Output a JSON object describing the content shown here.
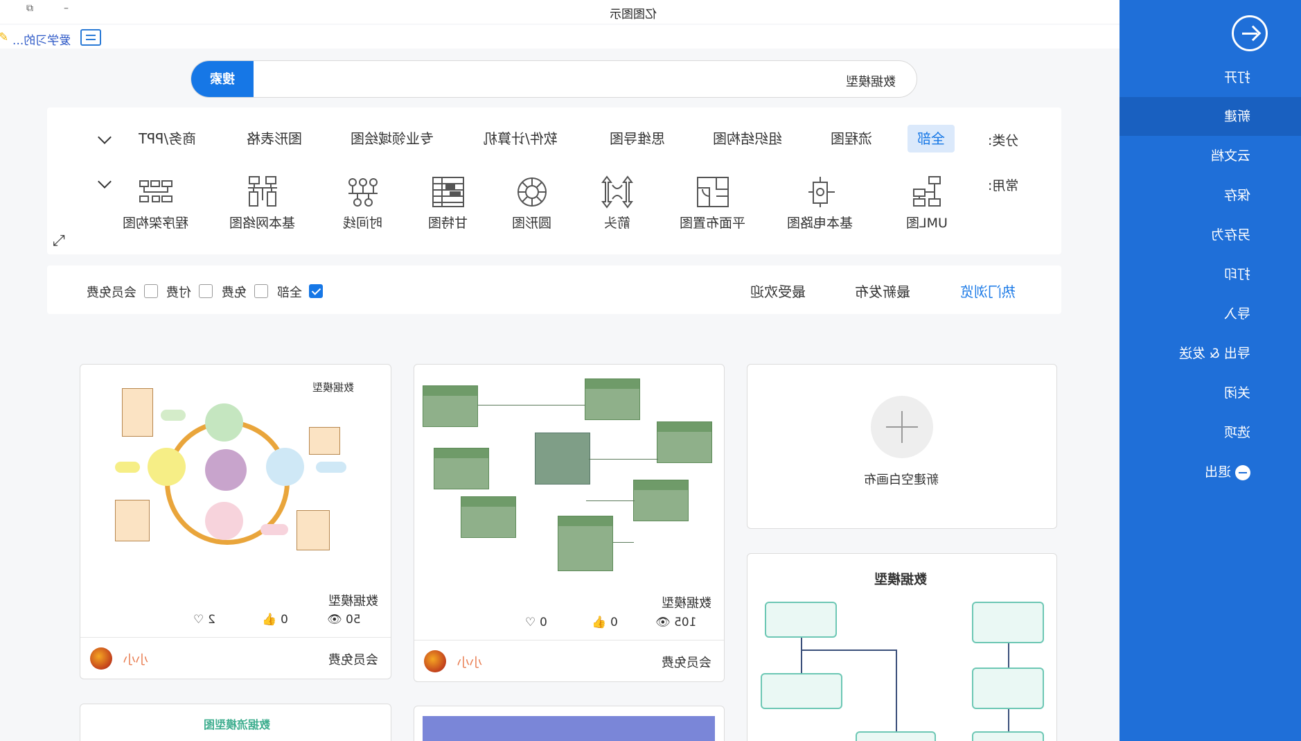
{
  "app": {
    "title": "亿图图示",
    "notice_text": "爱学习的..."
  },
  "search": {
    "button_label": "搜索",
    "value": "数据模型"
  },
  "categories": {
    "label": "分类:",
    "items": [
      "全部",
      "流程图",
      "组织结构图",
      "思维导图",
      "软件/计算机",
      "专业领域绘图",
      "图形表格",
      "商务/PPT"
    ],
    "active": "全部"
  },
  "common": {
    "label": "常用:",
    "items": [
      {
        "label": "UML图",
        "icon": "uml-icon"
      },
      {
        "label": "基本电路图",
        "icon": "circuit-icon"
      },
      {
        "label": "平面布置图",
        "icon": "floorplan-icon"
      },
      {
        "label": "箭头",
        "icon": "arrow-shape-icon"
      },
      {
        "label": "圆形图",
        "icon": "circle-diagram-icon"
      },
      {
        "label": "甘特图",
        "icon": "gantt-icon"
      },
      {
        "label": "时间线",
        "icon": "timeline-icon"
      },
      {
        "label": "基本网络图",
        "icon": "network-icon"
      },
      {
        "label": "程序架构图",
        "icon": "architecture-icon"
      }
    ]
  },
  "filter": {
    "sort_tabs": [
      "热门浏览",
      "最新发布",
      "最受欢迎"
    ],
    "active_sort": "热门浏览",
    "price_options": [
      {
        "label": "全部",
        "checked": true
      },
      {
        "label": "免费",
        "checked": false
      },
      {
        "label": "付费",
        "checked": false
      },
      {
        "label": "会员免费",
        "checked": false
      }
    ]
  },
  "new_blank": {
    "label": "新建空白画布"
  },
  "templates": [
    {
      "name": "数据模型",
      "views": "105",
      "likes": "0",
      "favorites": "0",
      "author": "小小",
      "price": "会员免费"
    },
    {
      "name": "数据模型",
      "diagram_title": "数据模型",
      "views": "50",
      "likes": "0",
      "favorites": "2",
      "author": "小小",
      "price": "会员免费"
    },
    {
      "diagram_title": "数据模型"
    },
    {
      "diagram_title": "数据流模型图"
    }
  ],
  "sidebar": {
    "items": [
      "打开",
      "新建",
      "云文档",
      "保存",
      "另存为",
      "打印",
      "导入",
      "导出 & 发送",
      "关闭",
      "选项",
      "退出"
    ],
    "active": "新建"
  },
  "colors": {
    "accent": "#1f6fd8",
    "button": "#1677e6",
    "author": "#e87b4e"
  }
}
